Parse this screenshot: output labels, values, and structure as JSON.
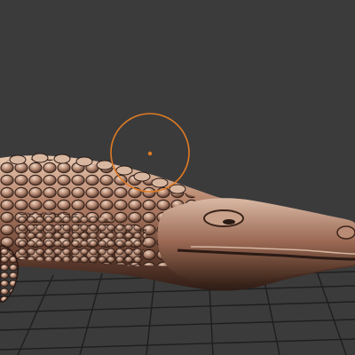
{
  "viewport": {
    "background_color": "#3b3b3b",
    "grid_color": "#1e1e1e",
    "model": "crocodile-sculpt",
    "model_palette": {
      "highlight": "#f2d4bd",
      "midtone": "#a9715a",
      "shadow": "#2a1a14"
    },
    "brush_cursor_color": "#e07b25",
    "brush_icon": "circle-brush-cursor-icon"
  }
}
